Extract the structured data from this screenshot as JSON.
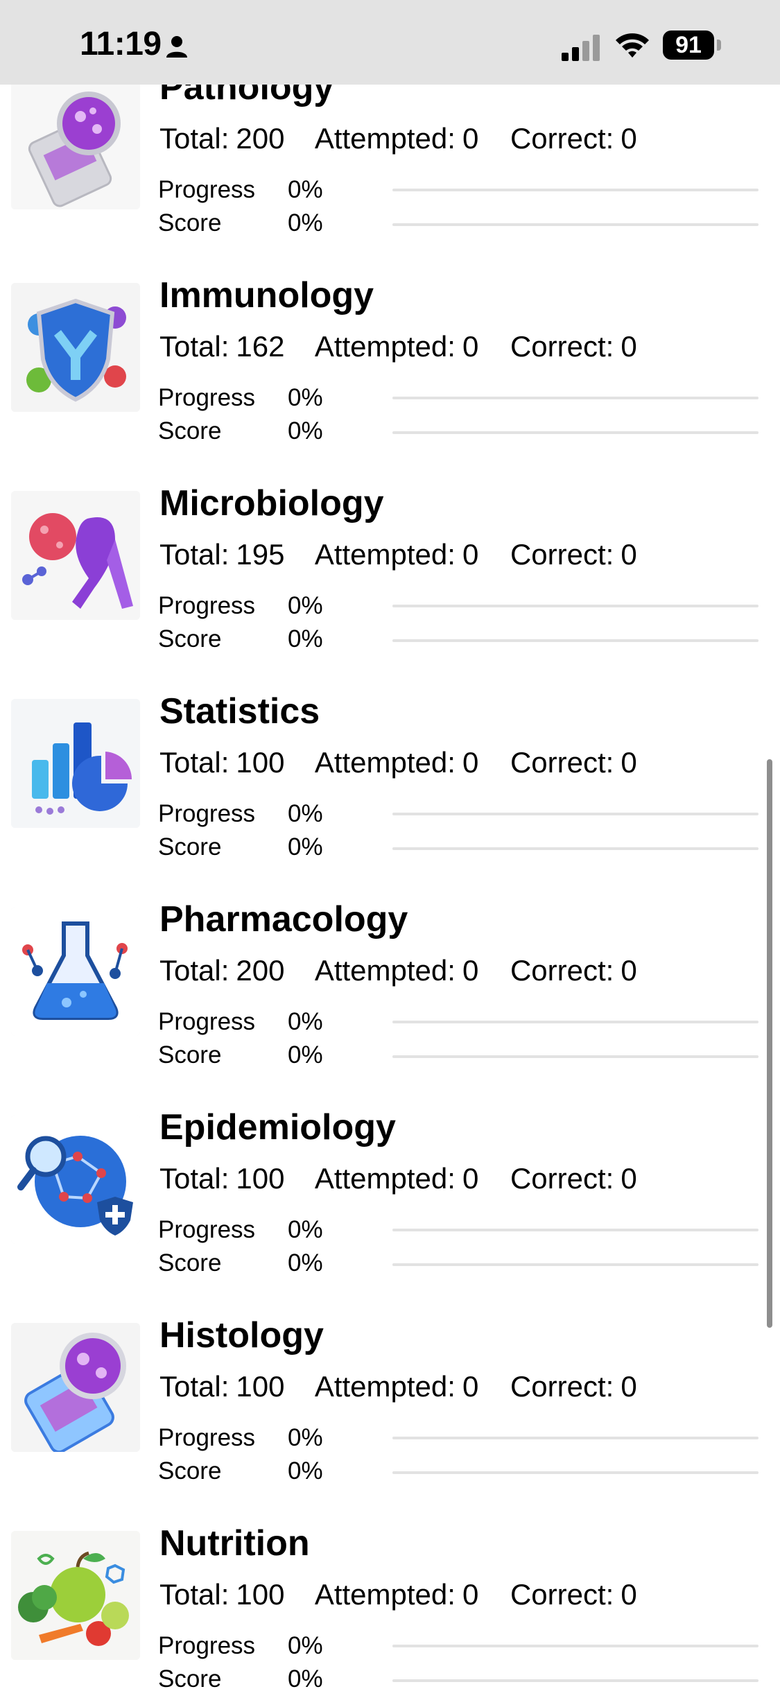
{
  "status_bar": {
    "time": "11:19",
    "battery": "91",
    "icons": [
      "person-icon",
      "cellular-signal-icon",
      "wifi-icon",
      "battery-icon"
    ]
  },
  "labels": {
    "total": "Total:",
    "attempted": "Attempted:",
    "correct": "Correct:",
    "progress": "Progress",
    "score": "Score"
  },
  "subjects": [
    {
      "title": "Pathology",
      "total": "200",
      "attempted": "0",
      "correct": "0",
      "progress": "0%",
      "score": "0%",
      "progress_fraction": 0,
      "score_fraction": 0,
      "icon": "pathology-icon"
    },
    {
      "title": "Immunology",
      "total": "162",
      "attempted": "0",
      "correct": "0",
      "progress": "0%",
      "score": "0%",
      "progress_fraction": 0,
      "score_fraction": 0,
      "icon": "immunology-icon"
    },
    {
      "title": "Microbiology",
      "total": "195",
      "attempted": "0",
      "correct": "0",
      "progress": "0%",
      "score": "0%",
      "progress_fraction": 0,
      "score_fraction": 0,
      "icon": "microbiology-icon"
    },
    {
      "title": "Statistics",
      "total": "100",
      "attempted": "0",
      "correct": "0",
      "progress": "0%",
      "score": "0%",
      "progress_fraction": 0,
      "score_fraction": 0,
      "icon": "statistics-icon"
    },
    {
      "title": "Pharmacology",
      "total": "200",
      "attempted": "0",
      "correct": "0",
      "progress": "0%",
      "score": "0%",
      "progress_fraction": 0,
      "score_fraction": 0,
      "icon": "pharmacology-icon"
    },
    {
      "title": "Epidemiology",
      "total": "100",
      "attempted": "0",
      "correct": "0",
      "progress": "0%",
      "score": "0%",
      "progress_fraction": 0,
      "score_fraction": 0,
      "icon": "epidemiology-icon"
    },
    {
      "title": "Histology",
      "total": "100",
      "attempted": "0",
      "correct": "0",
      "progress": "0%",
      "score": "0%",
      "progress_fraction": 0,
      "score_fraction": 0,
      "icon": "histology-icon"
    },
    {
      "title": "Nutrition",
      "total": "100",
      "attempted": "0",
      "correct": "0",
      "progress": "0%",
      "score": "0%",
      "progress_fraction": 0,
      "score_fraction": 0,
      "icon": "nutrition-icon"
    }
  ]
}
